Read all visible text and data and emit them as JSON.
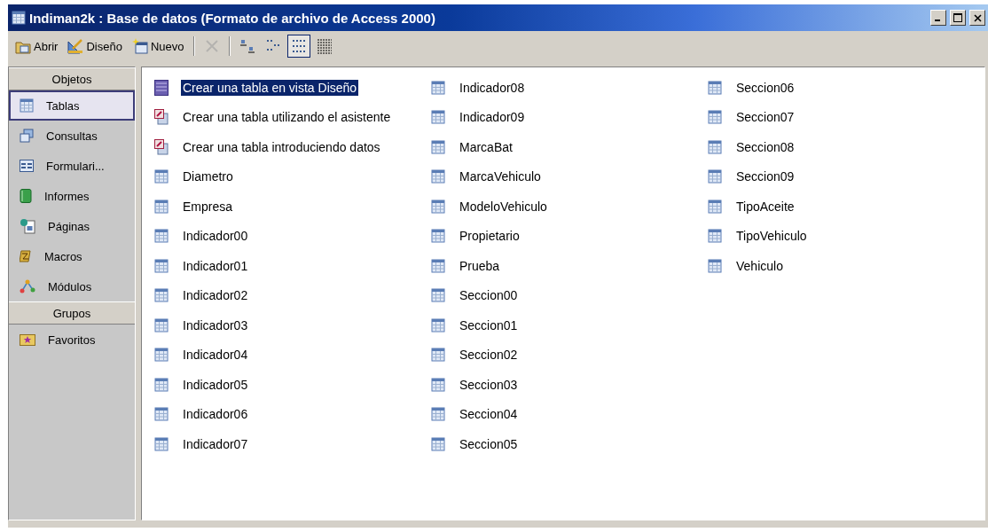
{
  "window": {
    "title": "Indiman2k : Base de datos (Formato de archivo de Access 2000)"
  },
  "toolbar": [
    {
      "kind": "open",
      "label": "Abrir",
      "disabled": false,
      "selected": false
    },
    {
      "kind": "design",
      "label": "Diseño",
      "disabled": false,
      "selected": false
    },
    {
      "kind": "new",
      "label": "Nuevo",
      "disabled": false,
      "selected": false
    },
    {
      "kind": "delete",
      "disabled": true,
      "selected": false
    },
    {
      "kind": "large-icons",
      "disabled": false,
      "selected": false
    },
    {
      "kind": "small-icons",
      "disabled": false,
      "selected": false
    },
    {
      "kind": "list",
      "disabled": false,
      "selected": true
    },
    {
      "kind": "details",
      "disabled": false,
      "selected": false
    }
  ],
  "sidebar": {
    "objects_header": "Objetos",
    "items": [
      {
        "kind": "tables",
        "label": "Tablas",
        "selected": true
      },
      {
        "kind": "queries",
        "label": "Consultas",
        "selected": false
      },
      {
        "kind": "forms",
        "label": "Formulari...",
        "selected": false
      },
      {
        "kind": "reports",
        "label": "Informes",
        "selected": false
      },
      {
        "kind": "pages",
        "label": "Páginas",
        "selected": false
      },
      {
        "kind": "macros",
        "label": "Macros",
        "selected": false
      },
      {
        "kind": "modules",
        "label": "Módulos",
        "selected": false
      }
    ],
    "groups_header": "Grupos",
    "groups": [
      {
        "kind": "favorites",
        "label": "Favoritos",
        "selected": false
      }
    ]
  },
  "items": [
    {
      "kind": "design",
      "label": "Crear una tabla en vista Diseño",
      "selected": true
    },
    {
      "kind": "wizard",
      "label": "Crear una tabla utilizando el asistente",
      "selected": false
    },
    {
      "kind": "wizard",
      "label": "Crear una tabla introduciendo datos",
      "selected": false
    },
    {
      "kind": "table",
      "label": "Diametro",
      "selected": false
    },
    {
      "kind": "table",
      "label": "Empresa",
      "selected": false
    },
    {
      "kind": "table",
      "label": "Indicador00",
      "selected": false
    },
    {
      "kind": "table",
      "label": "Indicador01",
      "selected": false
    },
    {
      "kind": "table",
      "label": "Indicador02",
      "selected": false
    },
    {
      "kind": "table",
      "label": "Indicador03",
      "selected": false
    },
    {
      "kind": "table",
      "label": "Indicador04",
      "selected": false
    },
    {
      "kind": "table",
      "label": "Indicador05",
      "selected": false
    },
    {
      "kind": "table",
      "label": "Indicador06",
      "selected": false
    },
    {
      "kind": "table",
      "label": "Indicador07",
      "selected": false
    },
    {
      "kind": "table",
      "label": "Indicador08",
      "selected": false
    },
    {
      "kind": "table",
      "label": "Indicador09",
      "selected": false
    },
    {
      "kind": "table",
      "label": "MarcaBat",
      "selected": false
    },
    {
      "kind": "table",
      "label": "MarcaVehiculo",
      "selected": false
    },
    {
      "kind": "table",
      "label": "ModeloVehiculo",
      "selected": false
    },
    {
      "kind": "table",
      "label": "Propietario",
      "selected": false
    },
    {
      "kind": "table",
      "label": "Prueba",
      "selected": false
    },
    {
      "kind": "table",
      "label": "Seccion00",
      "selected": false
    },
    {
      "kind": "table",
      "label": "Seccion01",
      "selected": false
    },
    {
      "kind": "table",
      "label": "Seccion02",
      "selected": false
    },
    {
      "kind": "table",
      "label": "Seccion03",
      "selected": false
    },
    {
      "kind": "table",
      "label": "Seccion04",
      "selected": false
    },
    {
      "kind": "table",
      "label": "Seccion05",
      "selected": false
    },
    {
      "kind": "table",
      "label": "Seccion06",
      "selected": false
    },
    {
      "kind": "table",
      "label": "Seccion07",
      "selected": false
    },
    {
      "kind": "table",
      "label": "Seccion08",
      "selected": false
    },
    {
      "kind": "table",
      "label": "Seccion09",
      "selected": false
    },
    {
      "kind": "table",
      "label": "TipoAceite",
      "selected": false
    },
    {
      "kind": "table",
      "label": "TipoVehiculo",
      "selected": false
    },
    {
      "kind": "table",
      "label": "Vehiculo",
      "selected": false
    }
  ]
}
